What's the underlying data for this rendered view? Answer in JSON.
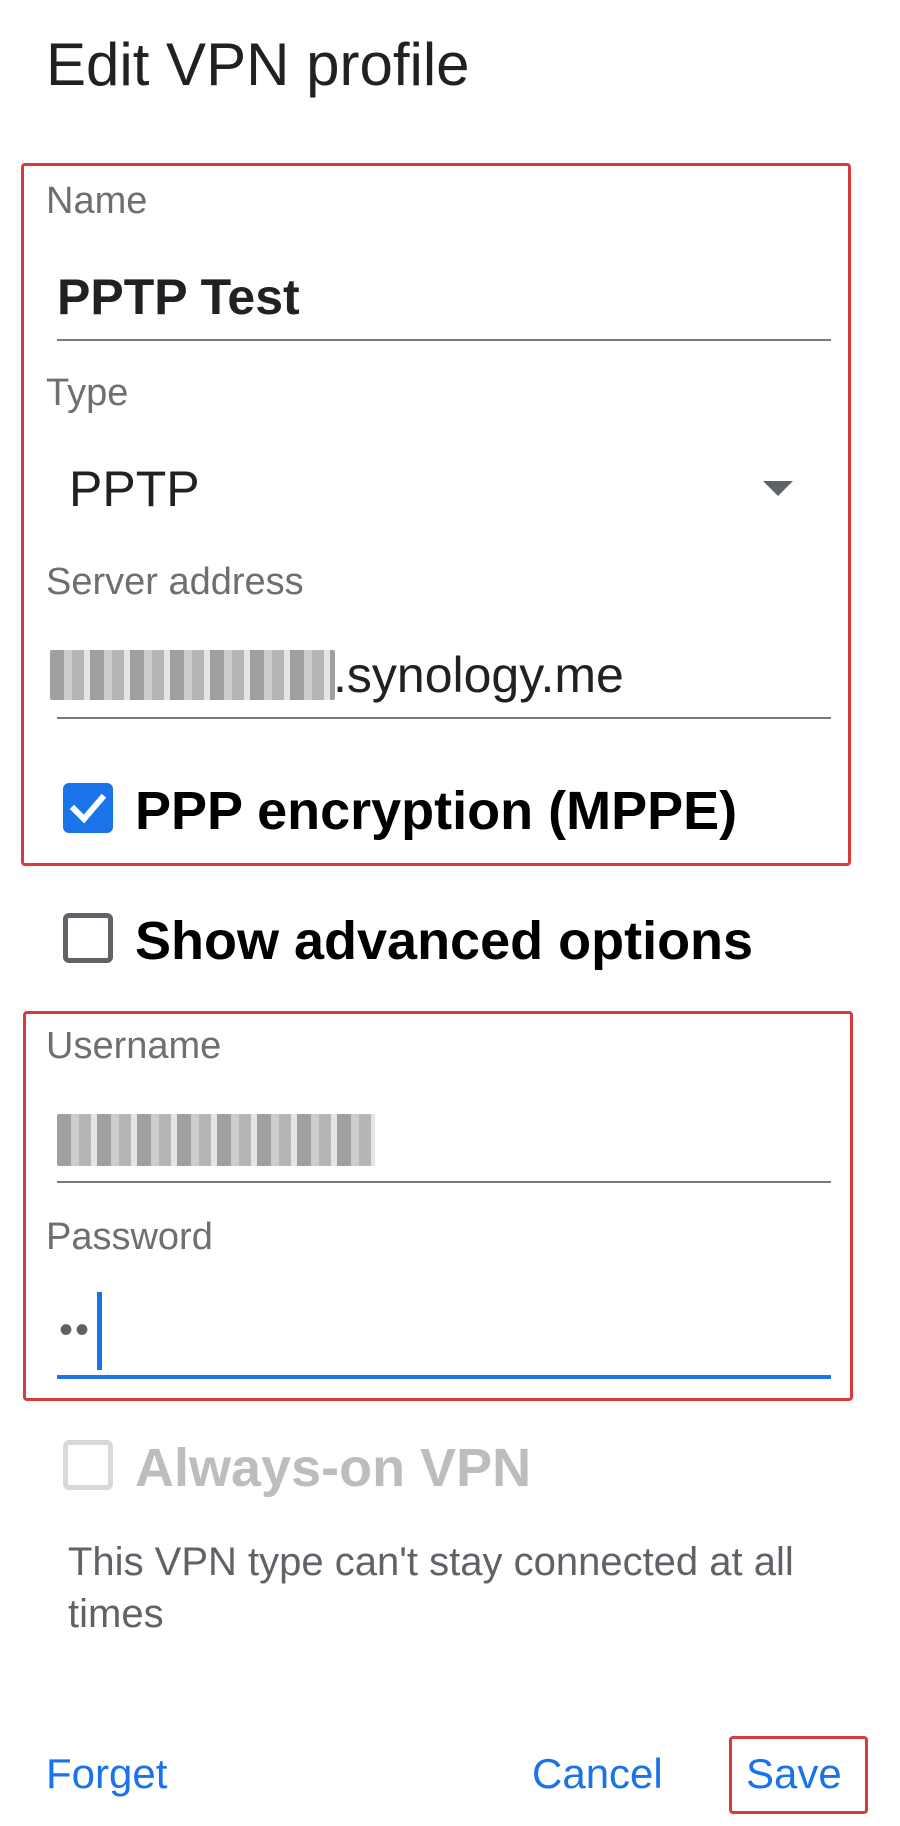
{
  "dialog": {
    "title": "Edit VPN profile"
  },
  "fields": {
    "name": {
      "label": "Name",
      "value": "PPTP Test"
    },
    "type": {
      "label": "Type",
      "value": "PPTP"
    },
    "server": {
      "label": "Server address",
      "value_suffix": ".synology.me"
    },
    "mppe": {
      "label": "PPP encryption (MPPE)",
      "checked": true
    },
    "advanced": {
      "label": "Show advanced options",
      "checked": false
    },
    "username": {
      "label": "Username"
    },
    "password": {
      "label": "Password",
      "mask": "••"
    },
    "always_on": {
      "label": "Always-on VPN",
      "checked": false,
      "enabled": false
    },
    "always_on_help": "This VPN type can't stay connected at all times"
  },
  "actions": {
    "forget": "Forget",
    "cancel": "Cancel",
    "save": "Save"
  },
  "colors": {
    "accent": "#1a73e8",
    "highlight_box": "#d83b3b"
  },
  "icons": {
    "check": "checkmark-icon",
    "dropdown": "dropdown-arrow-icon"
  }
}
